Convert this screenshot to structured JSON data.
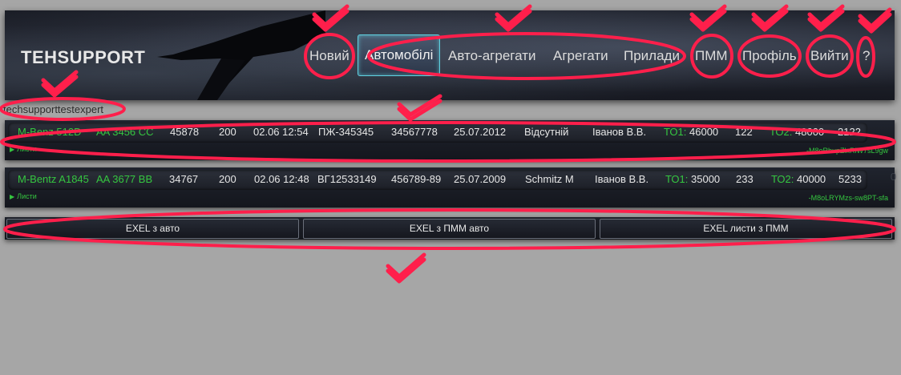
{
  "header": {
    "brand": "TEHSUPPORT",
    "nav": [
      {
        "label": "Новий"
      },
      {
        "label": "Автомобілі"
      },
      {
        "label": "Авто-агрегати"
      },
      {
        "label": "Агрегати"
      },
      {
        "label": "Прилади"
      },
      {
        "label": "ПММ"
      },
      {
        "label": "Профіль"
      },
      {
        "label": "Вийти"
      },
      {
        "label": "?"
      }
    ]
  },
  "user": {
    "name": "techsupporttestexpert"
  },
  "vehicles": [
    {
      "model": "M-Benz 512D",
      "plate": "AA 3456 CC",
      "mileage": "45878",
      "capacity": "200",
      "datetime": "02.06 12:54",
      "number1": "ПЖ-345345",
      "number2": "34567778",
      "date": "25.07.2012",
      "owner": "Відсутній",
      "driver": "Іванов В.В.",
      "to1_label": "ТО1:",
      "to1_value": "46000",
      "to1_rest": "122",
      "to2_label": "ТО2:",
      "to2_value": "48000",
      "to2_rest": "2122",
      "sheets_label": "Листи",
      "code": "-M8oRbupZlxRlW7sL9gw"
    },
    {
      "model": "M-Bentz A1845",
      "plate": "AA 3677 BB",
      "mileage": "34767",
      "capacity": "200",
      "datetime": "02.06 12:48",
      "number1": "ВГ12533149",
      "number2": "456789-89",
      "date": "25.07.2009",
      "owner": "Schmitz M",
      "driver": "Іванов В.В.",
      "to1_label": "ТО1:",
      "to1_value": "35000",
      "to1_rest": "233",
      "to2_label": "ТО2:",
      "to2_value": "40000",
      "to2_rest": "5233",
      "sheets_label": "Листи",
      "code": "-M8oLRYMzs-sw8PT-sfa",
      "extra": "0"
    }
  ],
  "exports": [
    {
      "label": "EXEL з авто"
    },
    {
      "label": "EXEL з ПММ авто"
    },
    {
      "label": "EXEL листи з ПММ"
    }
  ],
  "colors": {
    "annotation": "#ff1f4b",
    "accent_green": "#35c640",
    "active_border": "#5fd0e0",
    "page_bg": "#a6a6a6"
  }
}
